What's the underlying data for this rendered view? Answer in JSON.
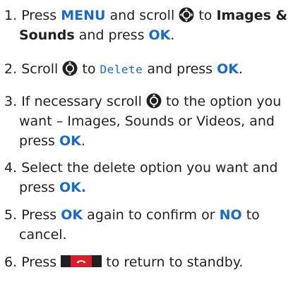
{
  "steps": [
    {
      "number": "1.",
      "t1": "Press",
      "menu_key": "MENU",
      "t2": "and scroll",
      "t3": "to",
      "target_line1": "Images &",
      "target_line2": "Sounds",
      "t4": "and press",
      "ok_key": "OK",
      "end": ".",
      "icon": "nav-joystick-4way-icon"
    },
    {
      "number": "2.",
      "t1": "Scroll",
      "t2": "to",
      "display_text": "Delete",
      "t3": "and press",
      "ok_key": "OK",
      "end": ".",
      "icon": "nav-joystick-updown-icon"
    },
    {
      "number": "3.",
      "t1": "If necessary scroll",
      "t2": "to the option you",
      "line2": "want – Images, Sounds or Videos, and",
      "t3": "press",
      "ok_key": "OK",
      "end": ".",
      "icon": "nav-joystick-updown-icon"
    },
    {
      "number": "4.",
      "line1": "Select the delete option you want and",
      "t2": "press",
      "ok_key": "OK."
    },
    {
      "number": "5.",
      "t1": "Press",
      "ok_key": "OK",
      "t2": "again to confirm or",
      "no_key": "NO",
      "t3": "to",
      "line2": "cancel."
    },
    {
      "number": "6.",
      "t1": "Press",
      "t2": "to return to standby.",
      "icon": "end-call-key-icon"
    }
  ],
  "colors": {
    "text": "#231f20",
    "key_blue": "#1a6bc4",
    "end_key_red": "#d51f2a"
  }
}
